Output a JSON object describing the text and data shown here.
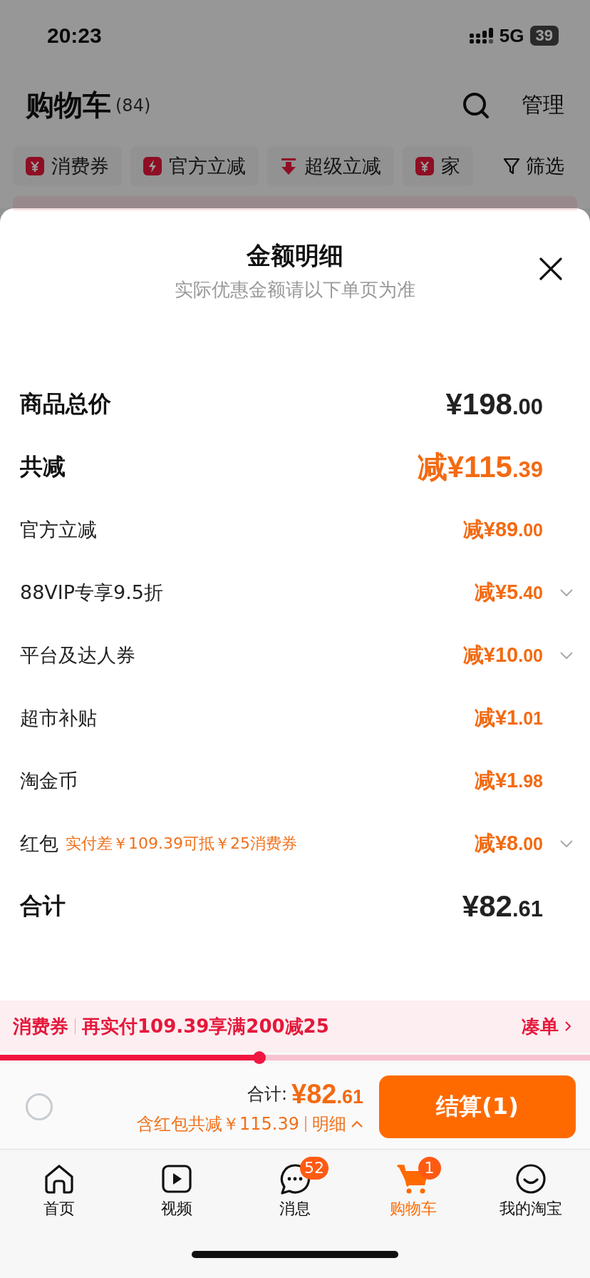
{
  "status_bar": {
    "time": "20:23",
    "network": "5G",
    "battery": "39"
  },
  "header": {
    "title": "购物车",
    "count": "(84)",
    "action": "管理"
  },
  "chips": [
    {
      "kind": "coupon",
      "label": "消费券"
    },
    {
      "kind": "bolt",
      "label": "官方立减"
    },
    {
      "kind": "arrow",
      "label": "超级立减"
    },
    {
      "kind": "coupon",
      "label": "家"
    }
  ],
  "filter": "筛选",
  "sheet": {
    "title": "金额明细",
    "subtitle": "实际优惠金额请以下单页为准",
    "rows": [
      {
        "kind": "total",
        "label": "商品总价",
        "main": "¥198",
        "decimal": ".00",
        "expandable": false
      },
      {
        "kind": "discount_total",
        "label": "共减",
        "main": "减¥115",
        "decimal": ".39",
        "expandable": false
      },
      {
        "kind": "discount",
        "label": "官方立减",
        "main": "减¥89",
        "decimal": ".00",
        "expandable": false
      },
      {
        "kind": "discount",
        "label": "88VIP专享9.5折",
        "main": "减¥5",
        "decimal": ".40",
        "expandable": true
      },
      {
        "kind": "discount",
        "label": "平台及达人券",
        "main": "减¥10",
        "decimal": ".00",
        "expandable": true
      },
      {
        "kind": "discount",
        "label": "超市补贴",
        "main": "减¥1",
        "decimal": ".01",
        "expandable": false
      },
      {
        "kind": "discount",
        "label": "淘金币",
        "main": "减¥1",
        "decimal": ".98",
        "expandable": false
      },
      {
        "kind": "discount",
        "label": "红包",
        "note": "实付差￥109.39可抵￥25消费券",
        "main": "减¥8",
        "decimal": ".00",
        "expandable": true
      },
      {
        "kind": "total",
        "label": "合计",
        "main": "¥82",
        "decimal": ".61",
        "expandable": false
      }
    ]
  },
  "promo": {
    "tag": "消费券",
    "text": "再实付109.39享满200减25",
    "link": "凑单",
    "level": 0.44
  },
  "checkout": {
    "checked": false,
    "total_label": "合计:",
    "total_main": "¥82",
    "total_decimal": ".61",
    "note": "含红包共减￥115.39",
    "detail": "明细",
    "button": "结算(1)"
  },
  "tabs": [
    {
      "kind": "home",
      "label": "首页",
      "selected": false
    },
    {
      "kind": "video",
      "label": "视频",
      "selected": false
    },
    {
      "kind": "chat",
      "label": "消息",
      "badge": "52",
      "selected": false
    },
    {
      "kind": "cart",
      "label": "购物车",
      "badge": "1",
      "selected": true
    },
    {
      "kind": "smile",
      "label": "我的淘宝",
      "selected": false
    }
  ]
}
